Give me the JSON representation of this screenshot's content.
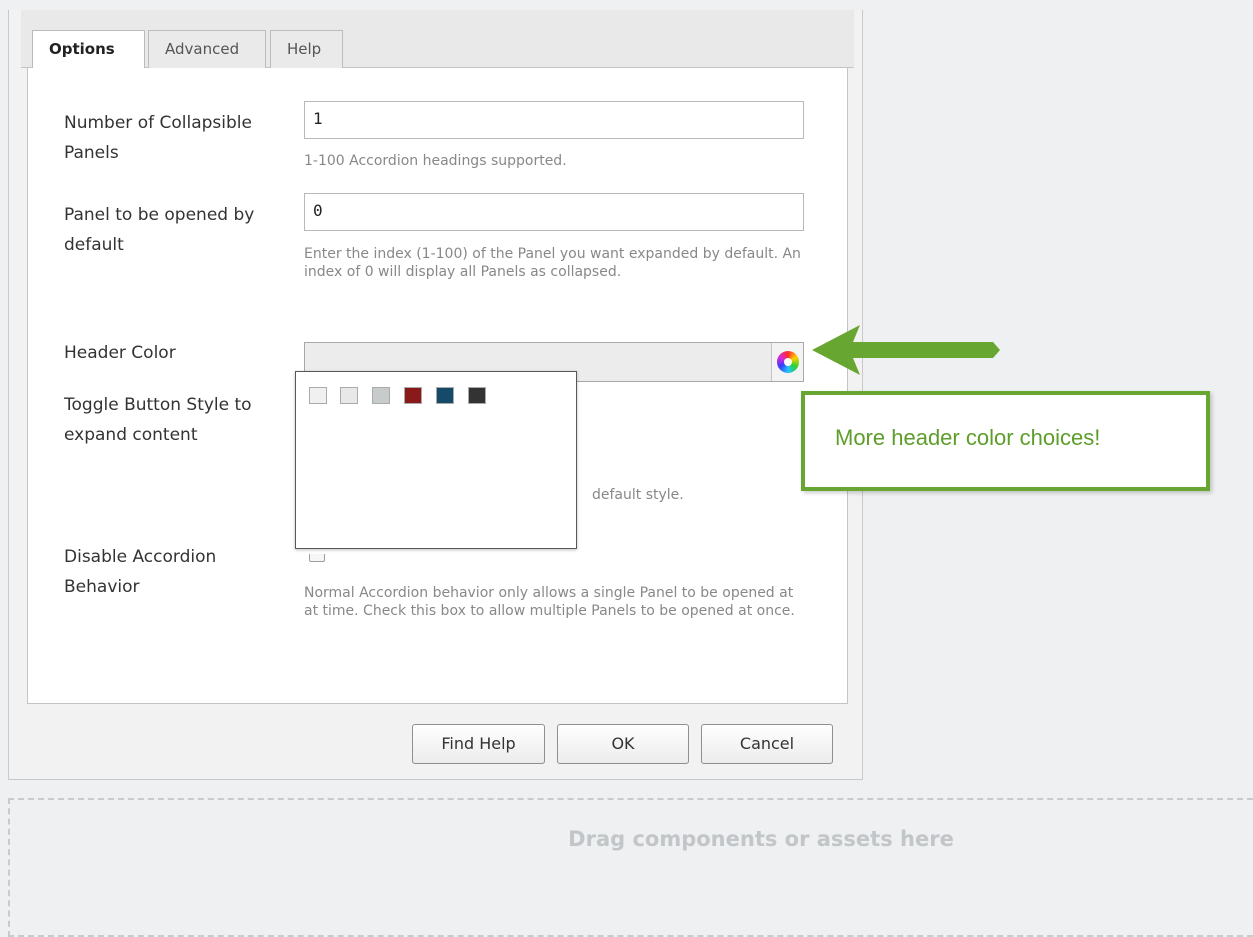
{
  "tabs": [
    {
      "label": "Options",
      "active": true
    },
    {
      "label": "Advanced",
      "active": false
    },
    {
      "label": "Help",
      "active": false
    }
  ],
  "fields": {
    "num_panels": {
      "label": "Number of Collapsible Panels",
      "value": "1",
      "help": "1-100 Accordion headings supported."
    },
    "default_panel": {
      "label": "Panel to be opened by default",
      "value": "0",
      "help": "Enter the index (1-100) of the Panel you want expanded by default. An index of 0 will display all Panels as collapsed."
    },
    "header_color": {
      "label": "Header Color",
      "value": "",
      "icon": "color-wheel-icon"
    },
    "toggle_style": {
      "label": "Toggle Button Style to expand content",
      "help_visible": "default style."
    },
    "disable_accordion": {
      "label": "Disable Accordion Behavior",
      "checked": false,
      "help": "Normal Accordion behavior only allows a single Panel to be opened at at time. Check this box to allow multiple Panels to be opened at once."
    }
  },
  "color_swatches": [
    "#f0f0f0",
    "#e8e8e8",
    "#c8cbcc",
    "#8a1a1a",
    "#154a68",
    "#333333"
  ],
  "buttons": {
    "find_help": "Find Help",
    "ok": "OK",
    "cancel": "Cancel"
  },
  "dropzone": {
    "text": "Drag components or assets here"
  },
  "annotation": {
    "text": "More header color choices!",
    "color": "#67a630"
  }
}
